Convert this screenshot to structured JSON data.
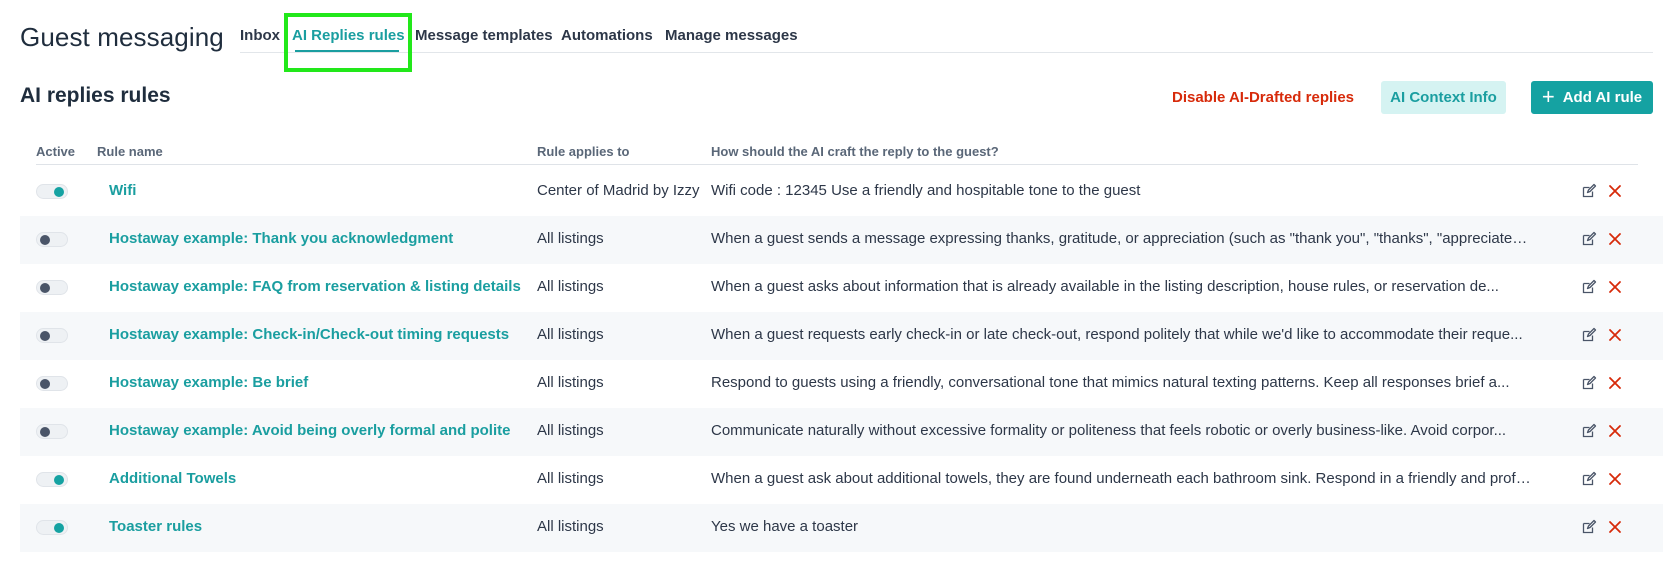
{
  "page": {
    "title": "Guest messaging"
  },
  "tabs": [
    {
      "label": "Inbox"
    },
    {
      "label": "AI Replies rules"
    },
    {
      "label": "Message templates"
    },
    {
      "label": "Automations"
    },
    {
      "label": "Manage messages"
    }
  ],
  "active_tab": "AI Replies rules",
  "section": {
    "title": "AI replies rules"
  },
  "actions": {
    "disable_label": "Disable AI-Drafted replies",
    "context_label": "AI Context Info",
    "add_label": "Add AI rule",
    "add_icon": "plus-icon"
  },
  "table": {
    "headers": {
      "active": "Active",
      "rule_name": "Rule name",
      "applies_to": "Rule applies to",
      "reply": "How should the AI craft the reply to the guest?"
    },
    "rows": [
      {
        "active": true,
        "name": "Wifi",
        "applies": "Center of Madrid by Izzy",
        "reply": "Wifi code : 12345 Use a friendly and hospitable tone to the guest"
      },
      {
        "active": false,
        "name": "Hostaway example: Thank you acknowledgment",
        "applies": "All listings",
        "reply": "When a guest sends a message expressing thanks, gratitude, or appreciation (such as \"thank you\", \"thanks\", \"appreciate i..."
      },
      {
        "active": false,
        "name": "Hostaway example: FAQ from reservation & listing details",
        "applies": "All listings",
        "reply": "When a guest asks about information that is already available in the listing description, house rules, or reservation de..."
      },
      {
        "active": false,
        "name": "Hostaway example: Check-in/Check-out timing requests",
        "applies": "All listings",
        "reply": "When a guest requests early check-in or late check-out, respond politely that while we'd like to accommodate their reque..."
      },
      {
        "active": false,
        "name": "Hostaway example: Be brief",
        "applies": "All listings",
        "reply": "Respond to guests using a friendly, conversational tone that mimics natural texting patterns. Keep all responses brief a..."
      },
      {
        "active": false,
        "name": "Hostaway example: Avoid being overly formal and polite",
        "applies": "All listings",
        "reply": "Communicate naturally without excessive formality or politeness that feels robotic or overly business-like. Avoid corpor..."
      },
      {
        "active": true,
        "name": "Additional Towels",
        "applies": "All listings",
        "reply": "When a guest ask about additional towels, they are found underneath each bathroom sink. Respond in a friendly and profes..."
      },
      {
        "active": true,
        "name": "Toaster rules",
        "applies": "All listings",
        "reply": "Yes we have a toaster"
      }
    ]
  },
  "colors": {
    "accent": "#15a2a2",
    "link": "#1a9ea0",
    "danger": "#d72a0a",
    "highlight": "#22e81a"
  }
}
